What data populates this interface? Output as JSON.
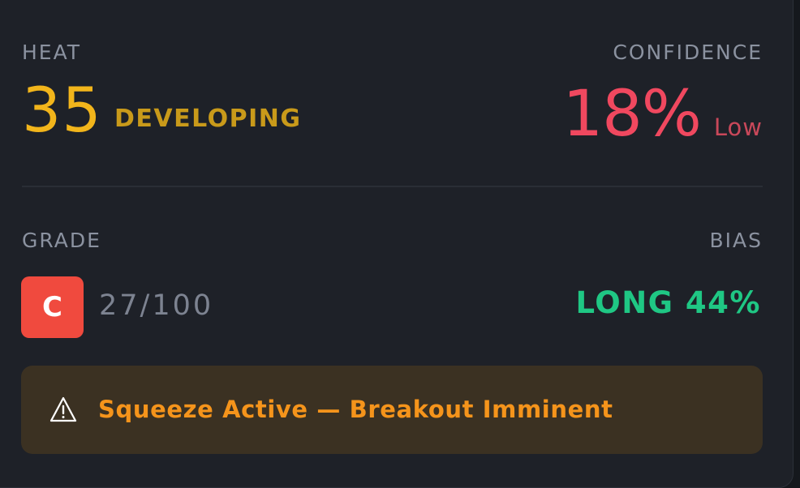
{
  "heat": {
    "label": "HEAT",
    "value": "35",
    "status": "DEVELOPING",
    "value_color": "#f2b51b",
    "status_color": "#c99a1a"
  },
  "confidence": {
    "label": "CONFIDENCE",
    "value": "18%",
    "level": "Low",
    "value_color": "#f0485f",
    "level_color": "#c9485a"
  },
  "grade": {
    "label": "GRADE",
    "letter": "C",
    "score": "27/100",
    "badge_color": "#f04a3e"
  },
  "bias": {
    "label": "BIAS",
    "value": "LONG 44%",
    "color": "#1fc784"
  },
  "alert": {
    "icon": "warning-triangle-icon",
    "text": "Squeeze Active — Breakout Imminent",
    "text_color": "#f5941b"
  }
}
